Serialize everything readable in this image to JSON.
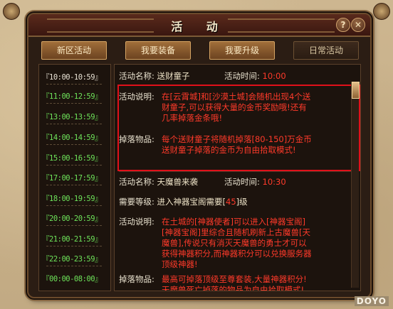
{
  "window": {
    "title": "活 动"
  },
  "tabs": [
    "新区活动",
    "我要装备",
    "我要升级",
    "日常活动"
  ],
  "times": [
    {
      "label": "『10:00-10:59』",
      "color": "white"
    },
    {
      "label": "『11:00-12:59』",
      "color": "green"
    },
    {
      "label": "『13:00-13:59』",
      "color": "green"
    },
    {
      "label": "『14:00-14:59』",
      "color": "green"
    },
    {
      "label": "『15:00-16:59』",
      "color": "green"
    },
    {
      "label": "『17:00-17:59』",
      "color": "green"
    },
    {
      "label": "『18:00-19:59』",
      "color": "green"
    },
    {
      "label": "『20:00-20:59』",
      "color": "green"
    },
    {
      "label": "『21:00-21:59』",
      "color": "green"
    },
    {
      "label": "『22:00-23:59』",
      "color": "green"
    },
    {
      "label": "『00:00-08:00』",
      "color": "green"
    }
  ],
  "event1": {
    "name_label": "活动名称:",
    "name": "送财童子",
    "time_label": "活动时间:",
    "time": "10:00",
    "desc_label": "活动说明:",
    "desc": [
      "在[云霄城]和[沙漠土城]会随机出现4个送",
      "财童子,可以获得大量的金币奖励哦!还有",
      "几率掉落金条哦!"
    ],
    "drop_label": "掉落物品:",
    "drop1": "每个送财童子将随机掉落[80-150]万金币",
    "drop2": "送财童子掉落的金币为自由拾取模式!"
  },
  "event2": {
    "name_label": "活动名称:",
    "name": "天魔兽来袭",
    "time_label": "活动时间:",
    "time": "10:30",
    "level_label": "需要等级:",
    "level_pre": "进入神器宝阁需要[",
    "level_num": "45",
    "level_post": "]级",
    "desc_label": "活动说明:",
    "desc1": "在土城的[神器使者]可以进入[神器宝阁]",
    "desc2": "[神器宝阁]里综合且随机刷新上古魔兽[天",
    "desc3": "魔兽],传说只有消灭天魔兽的勇士才可以",
    "desc4": "获得神器积分,而神器积分可以兑换服务器",
    "desc5": "顶级神器!",
    "drop_label": "掉落物品:",
    "drop1": "最高可掉落顶级至尊套装,大量神器积分!",
    "drop2": "天魔兽死亡掉落的物品为自由拾取模式!"
  },
  "logo": "DOYO",
  "icons": {
    "help": "help-icon",
    "close": "close-icon"
  }
}
